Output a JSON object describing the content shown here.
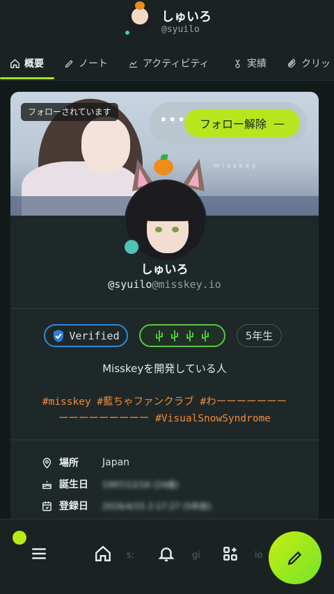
{
  "header": {
    "name": "しゅいろ",
    "handle": "@syuilo"
  },
  "tabs": [
    {
      "label": "概要",
      "icon": "home-icon",
      "active": true
    },
    {
      "label": "ノート",
      "icon": "pencil-icon"
    },
    {
      "label": "アクティビティ",
      "icon": "chart-line-icon"
    },
    {
      "label": "実績",
      "icon": "medal-icon"
    },
    {
      "label": "クリッ",
      "icon": "paperclip-icon"
    }
  ],
  "profile": {
    "followed_label": "フォローされています",
    "unfollow_label": "フォロー解除",
    "more_label": "•••",
    "banner_watermark": "misskey",
    "name": "しゅいろ",
    "username": "@syuilo",
    "host": "@misskey.io",
    "badges": {
      "verified": "Verified",
      "year": "5年生"
    },
    "bio": "Misskeyを開発している人",
    "tags_line1": "#misskey #藍ちゃファンクラブ #わーーーーーーー",
    "tags_line2": "ーーーーーーーーー #VisualSnowSyndrome",
    "fields": [
      {
        "key": "場所",
        "value": "Japan",
        "icon": "map-pin-icon"
      },
      {
        "key": "誕生日",
        "value": "1997/12/16 (24歳)",
        "icon": "cake-icon"
      },
      {
        "key": "登録日",
        "value": "2016/4/15 2:17:27 (5年前)",
        "icon": "calendar-icon"
      }
    ]
  },
  "nav": {
    "ghost_text": [
      "s:",
      "gi",
      "io"
    ]
  },
  "colors": {
    "accent": "#b6e61e",
    "online": "#4ec4b5",
    "hashtag": "#f08a3a",
    "verified": "#2b8ae0"
  }
}
